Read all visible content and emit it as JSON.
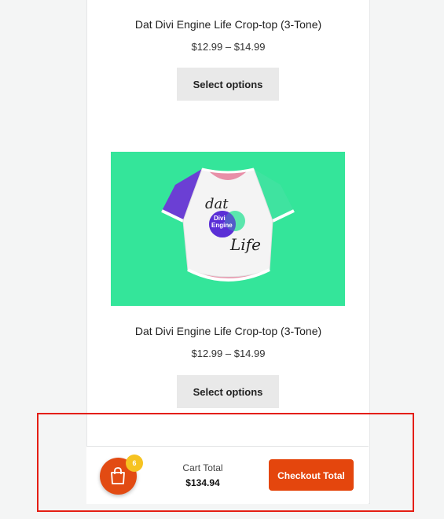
{
  "products": [
    {
      "title": "Dat Divi Engine Life Crop-top (3-Tone)",
      "price": "$12.99 – $14.99",
      "button_label": "Select options"
    },
    {
      "title": "Dat Divi Engine Life Crop-top (3-Tone)",
      "price": "$12.99 – $14.99",
      "button_label": "Select options",
      "image": {
        "background_color": "#34e59a",
        "shirt_text_top": "dat",
        "logo_line1": "Divi",
        "logo_line2": "Engine",
        "shirt_text_bottom": "Life"
      }
    }
  ],
  "cart_bar": {
    "count": "6",
    "total_label": "Cart Total",
    "total_value": "$134.94",
    "checkout_label": "Checkout Total",
    "icon": "shopping-bag-icon"
  },
  "colors": {
    "accent": "#e4460d",
    "badge": "#f6c321",
    "highlight": "#e41e14"
  }
}
